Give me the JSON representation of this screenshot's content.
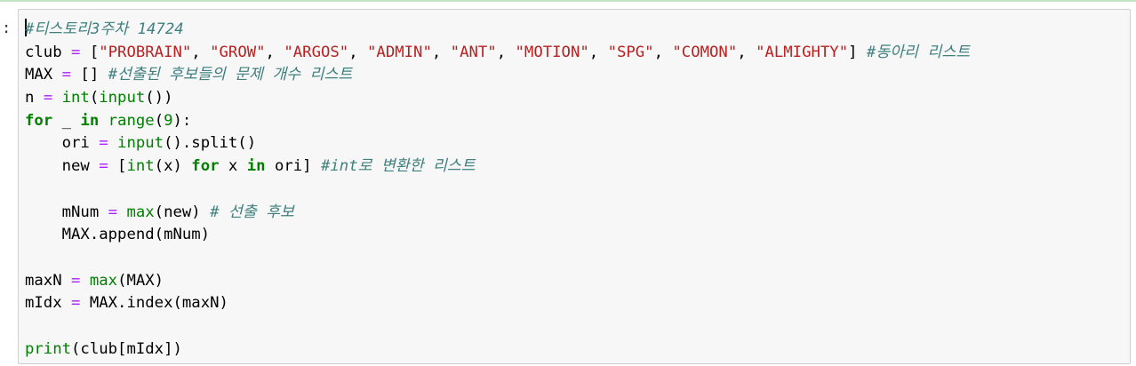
{
  "cell": {
    "prompt": ":",
    "lines": [
      [
        [
          "cm-comment",
          "#티스토리3주차 14724"
        ]
      ],
      [
        [
          "cm-plain",
          "club "
        ],
        [
          "cm-operator",
          "="
        ],
        [
          "cm-plain",
          " ["
        ],
        [
          "cm-string",
          "\"PROBRAIN\""
        ],
        [
          "cm-plain",
          ", "
        ],
        [
          "cm-string",
          "\"GROW\""
        ],
        [
          "cm-plain",
          ", "
        ],
        [
          "cm-string",
          "\"ARGOS\""
        ],
        [
          "cm-plain",
          ", "
        ],
        [
          "cm-string",
          "\"ADMIN\""
        ],
        [
          "cm-plain",
          ", "
        ],
        [
          "cm-string",
          "\"ANT\""
        ],
        [
          "cm-plain",
          ", "
        ],
        [
          "cm-string",
          "\"MOTION\""
        ],
        [
          "cm-plain",
          ", "
        ],
        [
          "cm-string",
          "\"SPG\""
        ],
        [
          "cm-plain",
          ", "
        ],
        [
          "cm-string",
          "\"COMON\""
        ],
        [
          "cm-plain",
          ", "
        ],
        [
          "cm-string",
          "\"ALMIGHTY\""
        ],
        [
          "cm-plain",
          "] "
        ],
        [
          "cm-comment",
          "#동아리 리스트"
        ]
      ],
      [
        [
          "cm-plain",
          "MAX "
        ],
        [
          "cm-operator",
          "="
        ],
        [
          "cm-plain",
          " [] "
        ],
        [
          "cm-comment",
          "#선출된 후보들의 문제 개수 리스트"
        ]
      ],
      [
        [
          "cm-plain",
          "n "
        ],
        [
          "cm-operator",
          "="
        ],
        [
          "cm-plain",
          " "
        ],
        [
          "cm-builtin",
          "int"
        ],
        [
          "cm-plain",
          "("
        ],
        [
          "cm-builtin",
          "input"
        ],
        [
          "cm-plain",
          "())"
        ]
      ],
      [
        [
          "cm-keyword",
          "for"
        ],
        [
          "cm-plain",
          " _ "
        ],
        [
          "cm-keyword",
          "in"
        ],
        [
          "cm-plain",
          " "
        ],
        [
          "cm-builtin",
          "range"
        ],
        [
          "cm-plain",
          "("
        ],
        [
          "cm-number",
          "9"
        ],
        [
          "cm-plain",
          "):"
        ]
      ],
      [
        [
          "cm-plain",
          "    ori "
        ],
        [
          "cm-operator",
          "="
        ],
        [
          "cm-plain",
          " "
        ],
        [
          "cm-builtin",
          "input"
        ],
        [
          "cm-plain",
          "().split()"
        ]
      ],
      [
        [
          "cm-plain",
          "    new "
        ],
        [
          "cm-operator",
          "="
        ],
        [
          "cm-plain",
          " ["
        ],
        [
          "cm-builtin",
          "int"
        ],
        [
          "cm-plain",
          "(x) "
        ],
        [
          "cm-keyword",
          "for"
        ],
        [
          "cm-plain",
          " x "
        ],
        [
          "cm-keyword",
          "in"
        ],
        [
          "cm-plain",
          " ori] "
        ],
        [
          "cm-comment",
          "#int로 변환한 리스트"
        ]
      ],
      [],
      [
        [
          "cm-plain",
          "    mNum "
        ],
        [
          "cm-operator",
          "="
        ],
        [
          "cm-plain",
          " "
        ],
        [
          "cm-builtin",
          "max"
        ],
        [
          "cm-plain",
          "(new) "
        ],
        [
          "cm-comment",
          "# 선출 후보"
        ]
      ],
      [
        [
          "cm-plain",
          "    MAX.append(mNum)"
        ]
      ],
      [],
      [
        [
          "cm-plain",
          "maxN "
        ],
        [
          "cm-operator",
          "="
        ],
        [
          "cm-plain",
          " "
        ],
        [
          "cm-builtin",
          "max"
        ],
        [
          "cm-plain",
          "(MAX)"
        ]
      ],
      [
        [
          "cm-plain",
          "mIdx "
        ],
        [
          "cm-operator",
          "="
        ],
        [
          "cm-plain",
          " MAX.index(maxN)"
        ]
      ],
      [],
      [
        [
          "cm-builtin",
          "print"
        ],
        [
          "cm-plain",
          "(club[mIdx])"
        ]
      ]
    ]
  }
}
